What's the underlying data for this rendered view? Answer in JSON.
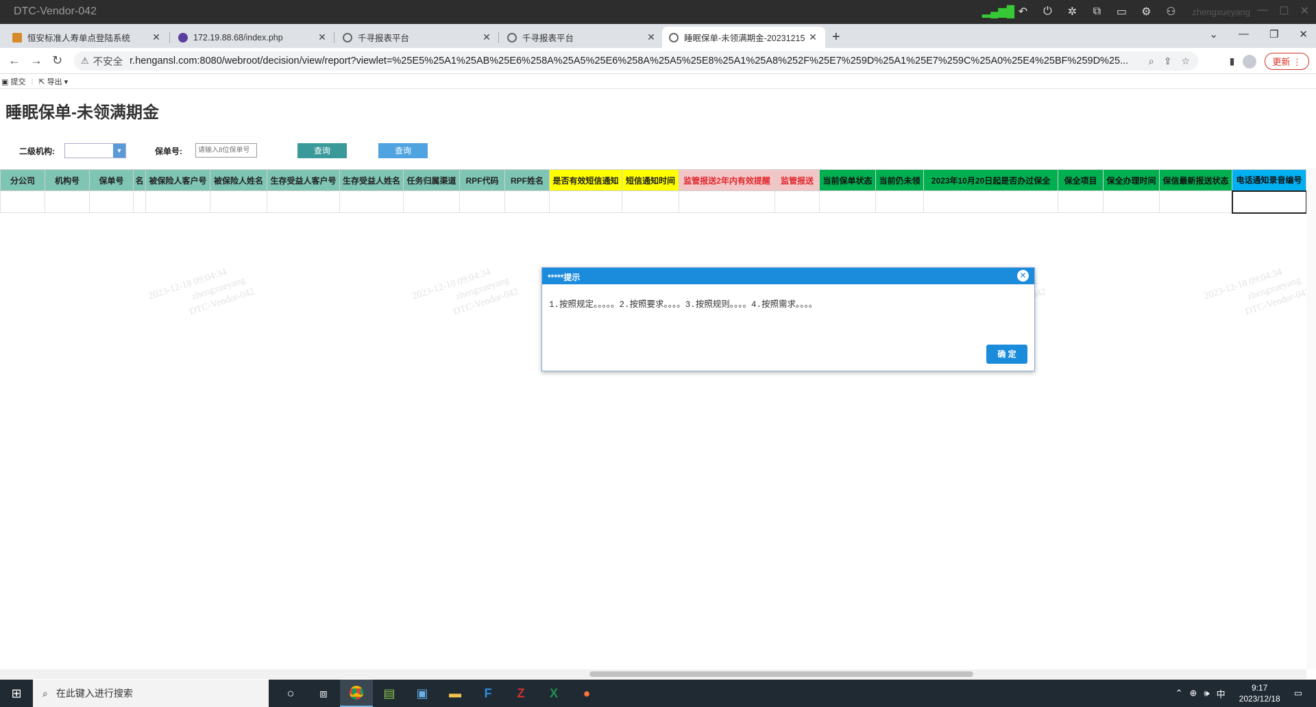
{
  "remote": {
    "title": "DTC-Vendor-042",
    "user": "zhengxueyang"
  },
  "tabs": [
    {
      "label": "恒安标准人寿单点登陆系统",
      "favicon_color": "#d68a2a"
    },
    {
      "label": "172.19.88.68/index.php",
      "favicon_color": "#5a3fa0"
    },
    {
      "label": "千寻报表平台",
      "favicon_color": "#666666"
    },
    {
      "label": "千寻报表平台",
      "favicon_color": "#666666"
    },
    {
      "label": "睡眠保单-未领满期金-20231215",
      "favicon_color": "#666666"
    }
  ],
  "address": {
    "security": "不安全",
    "url": "r.hengansl.com:8080/webroot/decision/view/report?viewlet=%25E5%25A1%25AB%25E6%258A%25A5%25E6%258A%25A5%25E8%25A1%25A8%252F%25E7%259D%25A1%25E7%259C%25A0%25E4%25BF%259D%25...",
    "update_label": "更新"
  },
  "report_toolbar": {
    "submit": "提交",
    "export": "导出"
  },
  "report": {
    "title": "睡眠保单-未领满期金",
    "filter_org_label": "二级机构:",
    "filter_policy_label": "保单号:",
    "policy_placeholder": "请输入8位保单号",
    "query1": "查询",
    "query2": "查询",
    "columns": [
      {
        "label": "分公司",
        "style": "teal"
      },
      {
        "label": "机构号",
        "style": "teal"
      },
      {
        "label": "保单号",
        "style": "teal"
      },
      {
        "label": "名",
        "style": "teal"
      },
      {
        "label": "被保险人客户号",
        "style": "teal"
      },
      {
        "label": "被保险人姓名",
        "style": "teal"
      },
      {
        "label": "生存受益人客户号",
        "style": "teal"
      },
      {
        "label": "生存受益人姓名",
        "style": "teal"
      },
      {
        "label": "任务归属渠道",
        "style": "teal"
      },
      {
        "label": "RPF代码",
        "style": "teal"
      },
      {
        "label": "RPF姓名",
        "style": "teal"
      },
      {
        "label": "是否有效短信通知",
        "style": "yellow"
      },
      {
        "label": "短信通知时间",
        "style": "yellow"
      },
      {
        "label": "监管报送2年内有效提醒",
        "style": "pink"
      },
      {
        "label": "监管报送",
        "style": "pink"
      },
      {
        "label": "当前保单状态",
        "style": "green"
      },
      {
        "label": "当前仍未领",
        "style": "green"
      },
      {
        "label": "2023年10月20日起是否办过保全",
        "style": "green"
      },
      {
        "label": "保全项目",
        "style": "green"
      },
      {
        "label": "保全办理时间",
        "style": "green"
      },
      {
        "label": "保信最新报送状态",
        "style": "green"
      },
      {
        "label": "电话通知录音编号",
        "style": "blue"
      }
    ]
  },
  "watermark": {
    "line1": "2023-12-18 09:04:34",
    "line2": "zhengxueyang",
    "line3": "DTC-Vendor-042"
  },
  "dialog": {
    "title": "*****提示",
    "message": "1.按照规定。。。。。2.按照要求。。。。3.按照规则。。。。4.按照需求。。。。",
    "ok": "确 定"
  },
  "taskbar": {
    "search_placeholder": "在此键入进行搜索",
    "ime": "中",
    "time": "9:17",
    "date": "2023/12/18"
  },
  "colors": {
    "dialog_blue": "#1b8cdc",
    "query1_bg": "#3a9a9a",
    "query2_bg": "#4ea3e0"
  }
}
